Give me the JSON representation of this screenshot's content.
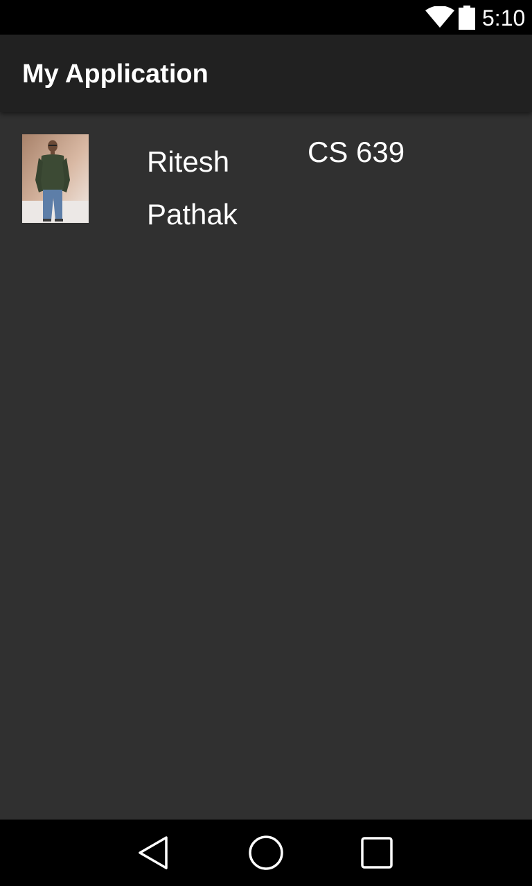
{
  "status_bar": {
    "time": "5:10",
    "icons": [
      "wifi-icon",
      "battery-icon"
    ]
  },
  "app_bar": {
    "title": "My Application"
  },
  "list": {
    "items": [
      {
        "photo": "person-photo",
        "name": "Ritesh Pathak",
        "course": "CS 639"
      }
    ]
  },
  "nav_bar": {
    "buttons": [
      "back-icon",
      "home-icon",
      "recents-icon"
    ]
  },
  "colors": {
    "status_bar_bg": "#000000",
    "app_bar_bg": "#212121",
    "content_bg": "#303030",
    "text": "#ffffff"
  }
}
